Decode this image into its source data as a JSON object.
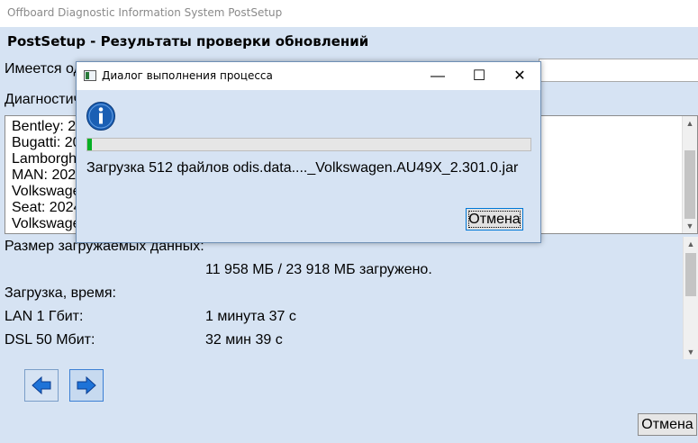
{
  "window": {
    "title": "Offboard Diagnostic Information System PostSetup"
  },
  "page": {
    "heading": "PostSetup - Результаты проверки обновлений"
  },
  "labels": {
    "available_partial": "Имеется од",
    "diagnostics_partial": "Диагностич",
    "size": "Размер загружаемых данных:",
    "size_value": "11 958 МБ / 23 918 МБ загружено.",
    "download_time": "Загрузка, время:",
    "lan_label": "LAN 1 Гбит:",
    "lan_value": "1 минута 37 с",
    "dsl50_label": "DSL 50 Мбит:",
    "dsl50_value": "32 мин 39 с"
  },
  "list": {
    "items": [
      "Bentley: 20",
      "Bugatti: 20",
      "Lamborgh",
      "MAN: 202",
      "Volkswage",
      "Seat: 2024",
      "Volkswage"
    ]
  },
  "buttons": {
    "cancel": "Отмена"
  },
  "icons": {
    "back": "left-arrow-icon",
    "forward": "right-arrow-icon",
    "info": "info-icon"
  },
  "dialog": {
    "title": "Диалог выполнения процесса",
    "message": "Загрузка 512 файлов odis.data...._Volkswagen.AU49X_2.301.0.jar",
    "cancel": "Отмена",
    "progress": 0.01,
    "controls": {
      "minimize": "—",
      "maximize": "☐",
      "close": "✕"
    }
  },
  "colors": {
    "background": "#d6e3f3",
    "progress": "#06b025",
    "info_blue": "#1a5fb4",
    "arrow_blue": "#1e73d8"
  }
}
